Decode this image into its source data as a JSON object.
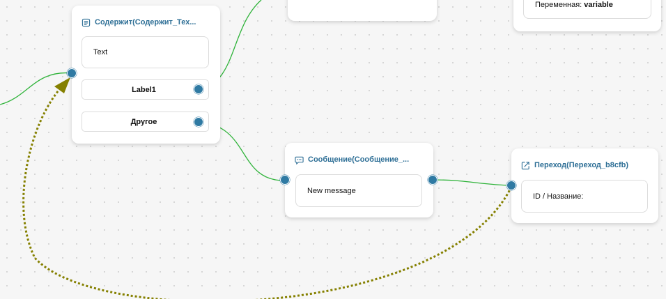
{
  "nodes": {
    "contains": {
      "title": "Содержит(Содержит_Тех...",
      "text": "Text",
      "options": [
        "Label1",
        "Другое"
      ]
    },
    "message": {
      "title": "Сообщение(Сообщение_...",
      "text": "New message"
    },
    "jump": {
      "title": "Переход(Переход_b8cfb)",
      "field": "ID / Название:"
    },
    "variable": {
      "label": "Переменная:",
      "value": "variable"
    }
  },
  "colors": {
    "edge": "#2fb33a",
    "loop_edge": "#858000",
    "handle": "#2f7aa3",
    "title": "#2e6f96"
  }
}
